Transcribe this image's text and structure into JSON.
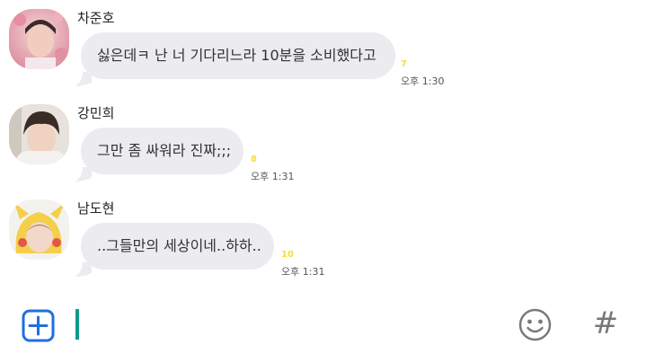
{
  "messages": [
    {
      "sender": "차준호",
      "text": "싫은데ㅋ 난 너 기다리느라 10분을 소비했다고",
      "unread": "7",
      "time": "오후 1:30"
    },
    {
      "sender": "강민희",
      "text": "그만 좀 싸워라 진짜;;;",
      "unread": "8",
      "time": "오후 1:31"
    },
    {
      "sender": "남도현",
      "text": "..그들만의 세상이네..하하..",
      "unread": "10",
      "time": "오후 1:31"
    }
  ],
  "input": {
    "add_icon": "plus-icon",
    "emoji_icon": "smiley-icon",
    "hashtag_label": "#"
  },
  "colors": {
    "bubble": "#ebebf0",
    "unread": "#f2df3a",
    "cursor": "#0e9a8a",
    "add_button": "#1f6fe0"
  }
}
